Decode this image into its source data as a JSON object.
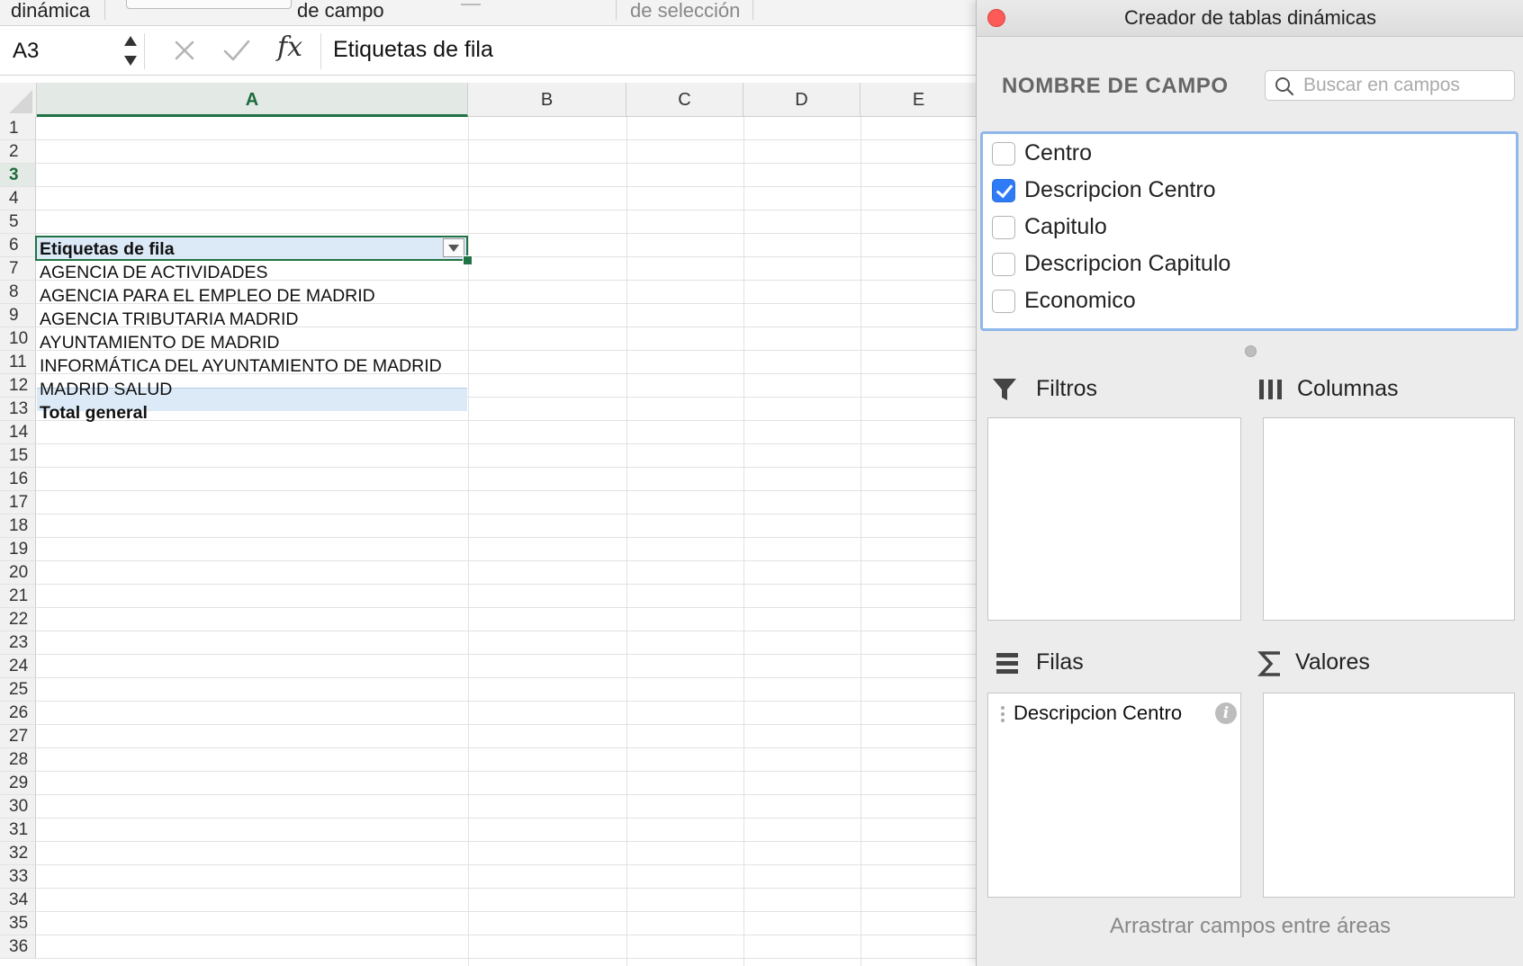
{
  "ribbon": {
    "items": [
      {
        "label": "dinámica"
      },
      {
        "label": "de campo"
      },
      {
        "label": "de selección"
      }
    ]
  },
  "formula_bar": {
    "name_box": "A3",
    "formula_value": "Etiquetas de fila"
  },
  "sheet": {
    "columns": [
      "A",
      "B",
      "C",
      "D",
      "E"
    ],
    "active_column": "A",
    "active_row": "3",
    "row_count": 36,
    "cells": {
      "a3": "Etiquetas de fila",
      "a4": "AGENCIA DE ACTIVIDADES",
      "a5": "AGENCIA PARA EL EMPLEO DE MADRID",
      "a6": "AGENCIA TRIBUTARIA MADRID",
      "a7": "AYUNTAMIENTO DE MADRID",
      "a8": "INFORMÁTICA DEL AYUNTAMIENTO DE MADRID",
      "a9": "MADRID SALUD",
      "a10": "Total general"
    }
  },
  "pivot_builder": {
    "title": "Creador de tablas dinámicas",
    "field_name_header": "NOMBRE DE CAMPO",
    "search_placeholder": "Buscar en campos",
    "fields": [
      {
        "label": "Centro",
        "checked": false
      },
      {
        "label": "Descripcion Centro",
        "checked": true
      },
      {
        "label": "Capitulo",
        "checked": false
      },
      {
        "label": "Descripcion Capitulo",
        "checked": false
      },
      {
        "label": "Economico",
        "checked": false
      }
    ],
    "areas": {
      "filters": "Filtros",
      "columns": "Columnas",
      "rows": "Filas",
      "values": "Valores"
    },
    "row_fields": [
      "Descripcion Centro"
    ],
    "info_glyph": "i",
    "drag_hint": "Arrastrar campos entre áreas"
  },
  "colors": {
    "excel_green": "#217346",
    "selection_fill": "#dce9f6",
    "checkbox_blue": "#2e7bf6",
    "close_red": "#fc5b57"
  }
}
